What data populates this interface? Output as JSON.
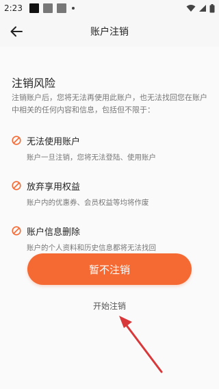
{
  "status_bar": {
    "time": "2:23"
  },
  "header": {
    "title": "账户注销"
  },
  "risk": {
    "title": "注销风险",
    "description": "注销账户后，您将无法再使用此账户，也无法找回您在账户中相关的任何内容和信息，包括但不限于：",
    "items": [
      {
        "title": "无法使用账户",
        "desc": "账户一旦注销，您将无法登陆、使用账户"
      },
      {
        "title": "放弃享用权益",
        "desc": "账户内的优惠券、会员权益等均将作废"
      },
      {
        "title": "账户信息删除",
        "desc": "账户的个人资料和历史信息都将无法找回"
      }
    ]
  },
  "actions": {
    "keep_label": "暂不注销",
    "start_label": "开始注销"
  },
  "colors": {
    "accent": "#f56a33",
    "annotation": "#d9383a"
  }
}
